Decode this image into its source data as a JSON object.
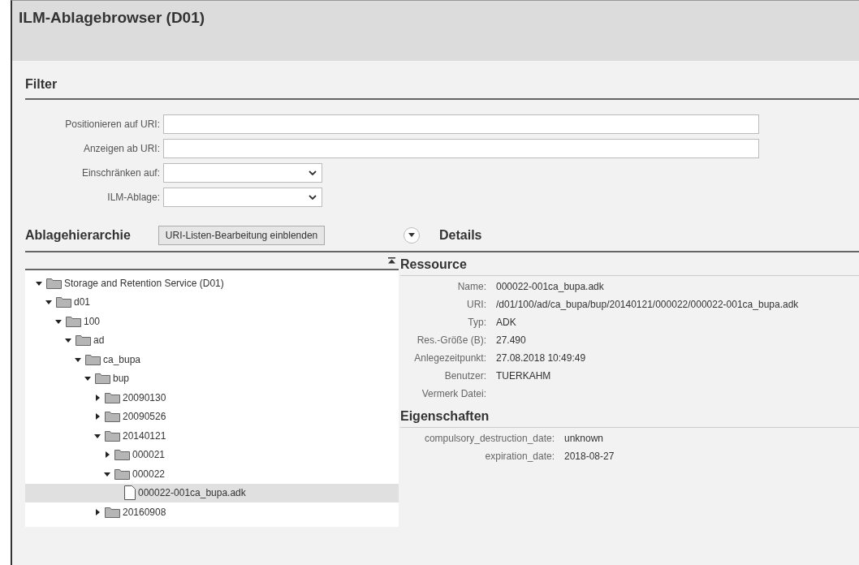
{
  "window": {
    "title": "ILM-Ablagebrowser (D01)"
  },
  "filter": {
    "title": "Filter",
    "fields": [
      {
        "kind": "text",
        "label": "Positionieren auf URI:"
      },
      {
        "kind": "text",
        "label": "Anzeigen ab URI:"
      },
      {
        "kind": "select",
        "label": "Einschränken auf:"
      },
      {
        "kind": "select",
        "label": "ILM-Ablage:"
      }
    ]
  },
  "hierarchy": {
    "title": "Ablagehierarchie",
    "button": "URI-Listen-Bearbeitung einblenden",
    "tree": [
      {
        "kind": "folder",
        "label": "Storage and Retention Service (D01)",
        "expanded": true,
        "selected": false,
        "children": [
          {
            "kind": "folder",
            "label": "d01",
            "expanded": true,
            "selected": false,
            "children": [
              {
                "kind": "folder",
                "label": "100",
                "expanded": true,
                "selected": false,
                "children": [
                  {
                    "kind": "folder",
                    "label": "ad",
                    "expanded": true,
                    "selected": false,
                    "children": [
                      {
                        "kind": "folder",
                        "label": "ca_bupa",
                        "expanded": true,
                        "selected": false,
                        "children": [
                          {
                            "kind": "folder",
                            "label": "bup",
                            "expanded": true,
                            "selected": false,
                            "children": [
                              {
                                "kind": "folder",
                                "label": "20090130",
                                "expanded": false,
                                "selected": false
                              },
                              {
                                "kind": "folder",
                                "label": "20090526",
                                "expanded": false,
                                "selected": false
                              },
                              {
                                "kind": "folder",
                                "label": "20140121",
                                "expanded": true,
                                "selected": false,
                                "children": [
                                  {
                                    "kind": "folder",
                                    "label": "000021",
                                    "expanded": false,
                                    "selected": false
                                  },
                                  {
                                    "kind": "folder",
                                    "label": "000022",
                                    "expanded": true,
                                    "selected": false,
                                    "children": [
                                      {
                                        "kind": "file",
                                        "label": "000022-001ca_bupa.adk",
                                        "selected": true
                                      }
                                    ]
                                  }
                                ]
                              },
                              {
                                "kind": "folder",
                                "label": "20160908",
                                "expanded": false,
                                "selected": false
                              }
                            ]
                          }
                        ]
                      }
                    ]
                  }
                ]
              }
            ]
          }
        ]
      }
    ]
  },
  "details": {
    "title": "Details",
    "expanded": true,
    "sections": [
      {
        "title": "Ressource",
        "rows": [
          {
            "label": "Name:",
            "value": "000022-001ca_bupa.adk"
          },
          {
            "label": "URI:",
            "value": "/d01/100/ad/ca_bupa/bup/20140121/000022/000022-001ca_bupa.adk"
          },
          {
            "label": "Typ:",
            "value": "ADK"
          },
          {
            "label": "Res.-Größe (B):",
            "value": "27.490"
          },
          {
            "label": "Anlegezeitpunkt:",
            "value": "27.08.2018 10:49:49"
          },
          {
            "label": "Benutzer:",
            "value": "TUERKAHM"
          },
          {
            "label": "Vermerk Datei:"
          }
        ]
      },
      {
        "title": "Eigenschaften",
        "rows": [
          {
            "label": "compulsory_destruction_date:",
            "value": "unknown"
          },
          {
            "label": "expiration_date:",
            "value": "2018-08-27"
          }
        ]
      }
    ]
  }
}
